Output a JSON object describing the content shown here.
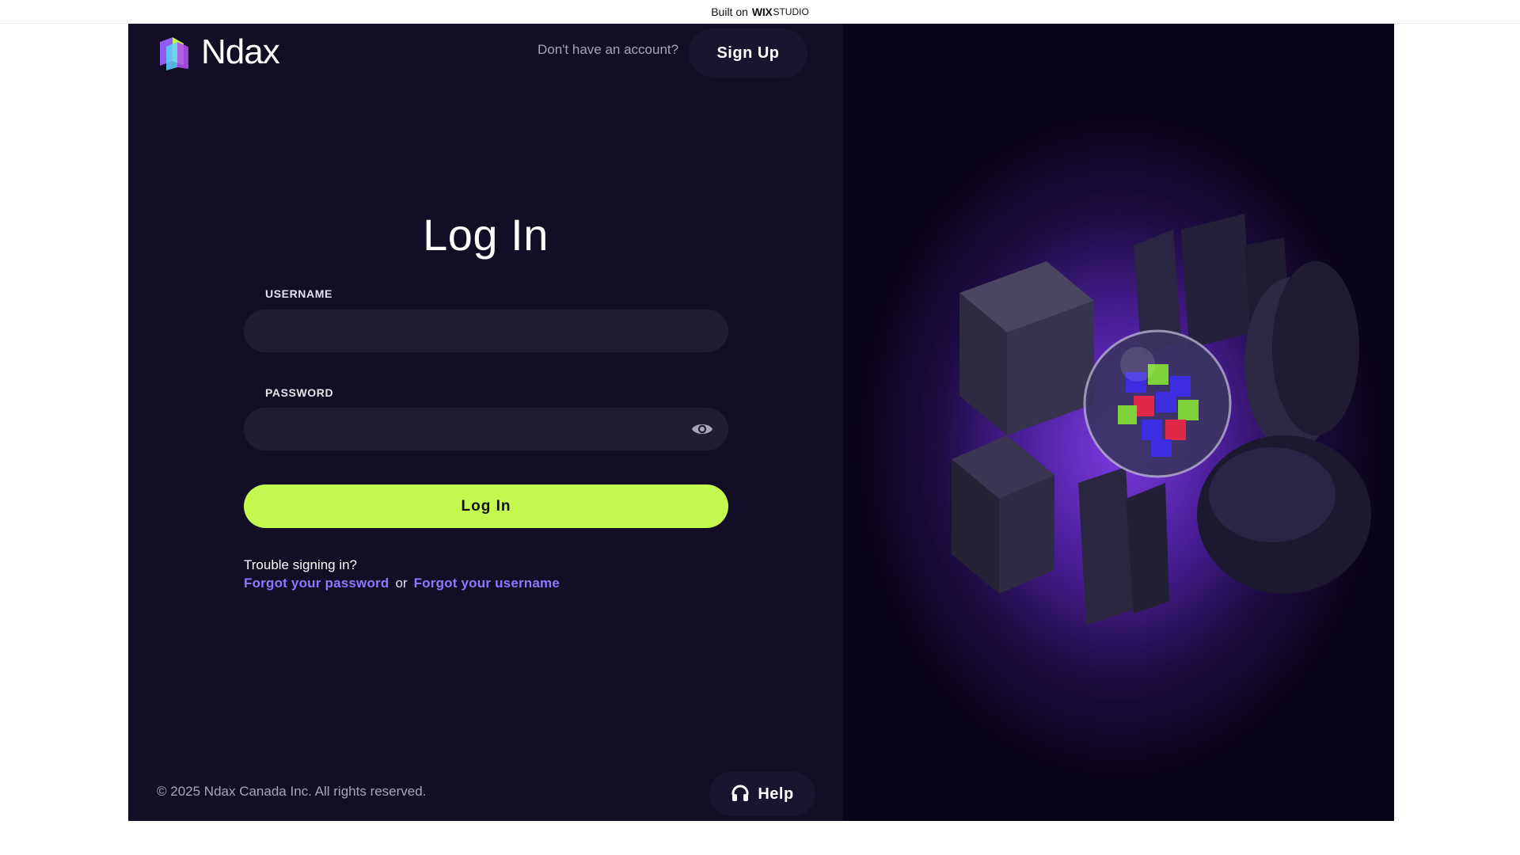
{
  "top_bar": {
    "built_on": "Built on",
    "brand": "WIX",
    "brand_suffix": "STUDIO"
  },
  "header": {
    "logo_text": "Ndax",
    "signup_prompt": "Don't have an account?",
    "signup_label": "Sign Up"
  },
  "form": {
    "title": "Log In",
    "username_label": "USERNAME",
    "username_value": "",
    "password_label": "PASSWORD",
    "password_value": "",
    "submit_label": "Log In",
    "trouble_text": "Trouble signing in?",
    "forgot_password": "Forgot your password",
    "or_text": "or",
    "forgot_username": "Forgot your username"
  },
  "footer": {
    "copyright": "© 2025 Ndax Canada Inc. All rights reserved.",
    "help_label": "Help"
  },
  "colors": {
    "panel_bg": "#130d25",
    "input_bg": "#221c33",
    "accent_green": "#c4fa4f",
    "link_purple": "#8d79ff",
    "glow_purple": "#7a3be0"
  },
  "icons": [
    "ndax-logo-icon",
    "eye-icon",
    "headset-icon"
  ]
}
